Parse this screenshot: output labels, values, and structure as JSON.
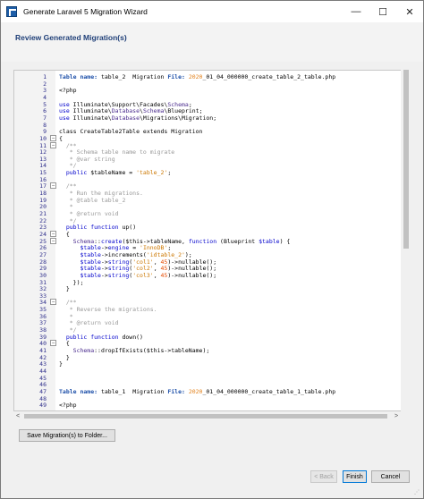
{
  "window": {
    "title": "Generate Laravel 5 Migration Wizard",
    "controls": {
      "minimize": "—",
      "maximize": "☐",
      "close": "✕"
    }
  },
  "header": {
    "title": "Review Generated Migration(s)"
  },
  "editor": {
    "lines": [
      {
        "n": "1",
        "segments": [
          [
            "hdr",
            "Table name: "
          ],
          [
            "cls",
            "table_2  Migration "
          ],
          [
            "hdr",
            "File: "
          ],
          [
            "date",
            "2020"
          ],
          [
            "cls",
            "_01_04_000000_create_table_2_table.php"
          ]
        ]
      },
      {
        "n": "2",
        "segments": []
      },
      {
        "n": "3",
        "segments": [
          [
            "cls",
            "<?php"
          ]
        ]
      },
      {
        "n": "4",
        "segments": []
      },
      {
        "n": "5",
        "segments": [
          [
            "kw",
            "use "
          ],
          [
            "cls",
            "Illuminate\\Support\\Facades\\"
          ],
          [
            "nsb",
            "Schema"
          ],
          [
            "cls",
            ";"
          ]
        ]
      },
      {
        "n": "6",
        "segments": [
          [
            "kw",
            "use "
          ],
          [
            "cls",
            "Illuminate\\"
          ],
          [
            "nsb",
            "Database"
          ],
          [
            "cls",
            "\\"
          ],
          [
            "nsb",
            "Schema"
          ],
          [
            "cls",
            "\\Blueprint;"
          ]
        ]
      },
      {
        "n": "7",
        "segments": [
          [
            "kw",
            "use "
          ],
          [
            "cls",
            "Illuminate\\"
          ],
          [
            "nsb",
            "Database"
          ],
          [
            "cls",
            "\\Migrations\\Migration;"
          ]
        ]
      },
      {
        "n": "8",
        "segments": []
      },
      {
        "n": "9",
        "segments": [
          [
            "cls",
            "class CreateTable2Table extends Migration"
          ]
        ]
      },
      {
        "n": "10",
        "segments": [
          [
            "cls",
            "{"
          ]
        ],
        "fold": true
      },
      {
        "n": "11",
        "segments": [
          [
            "cm",
            "  /**"
          ]
        ],
        "fold": true
      },
      {
        "n": "12",
        "segments": [
          [
            "cm",
            "   * Schema table name to migrate"
          ]
        ]
      },
      {
        "n": "13",
        "segments": [
          [
            "cm",
            "   * @var string"
          ]
        ]
      },
      {
        "n": "14",
        "segments": [
          [
            "cm",
            "   */"
          ]
        ]
      },
      {
        "n": "15",
        "segments": [
          [
            "kw",
            "  public "
          ],
          [
            "cls",
            "$tableName = "
          ],
          [
            "str",
            "'table_2'"
          ],
          [
            "cls",
            ";"
          ]
        ]
      },
      {
        "n": "16",
        "segments": []
      },
      {
        "n": "17",
        "segments": [
          [
            "cm",
            "  /**"
          ]
        ],
        "fold": true
      },
      {
        "n": "18",
        "segments": [
          [
            "cm",
            "   * Run the migrations."
          ]
        ]
      },
      {
        "n": "19",
        "segments": [
          [
            "cm",
            "   * @table table_2"
          ]
        ]
      },
      {
        "n": "20",
        "segments": [
          [
            "cm",
            "   *"
          ]
        ]
      },
      {
        "n": "21",
        "segments": [
          [
            "cm",
            "   * @return void"
          ]
        ]
      },
      {
        "n": "22",
        "segments": [
          [
            "cm",
            "   */"
          ]
        ]
      },
      {
        "n": "23",
        "segments": [
          [
            "kw",
            "  public function "
          ],
          [
            "cls",
            "up()"
          ]
        ]
      },
      {
        "n": "24",
        "segments": [
          [
            "cls",
            "  {"
          ]
        ],
        "fold": true
      },
      {
        "n": "25",
        "segments": [
          [
            "nsb",
            "    Schema"
          ],
          [
            "cls",
            "::"
          ],
          [
            "kw",
            "create"
          ],
          [
            "cls",
            "($this->tableName, "
          ],
          [
            "kw",
            "function "
          ],
          [
            "cls",
            "(Blueprint "
          ],
          [
            "kw",
            "$table"
          ],
          [
            "cls",
            ") {"
          ]
        ],
        "fold": true
      },
      {
        "n": "26",
        "segments": [
          [
            "kw",
            "      $table"
          ],
          [
            "cls",
            "->"
          ],
          [
            "kw",
            "engine "
          ],
          [
            "cls",
            "= "
          ],
          [
            "str",
            "'InnoDB'"
          ],
          [
            "cls",
            ";"
          ]
        ]
      },
      {
        "n": "27",
        "segments": [
          [
            "kw",
            "      $table"
          ],
          [
            "cls",
            "->increments("
          ],
          [
            "str",
            "'idtable_2'"
          ],
          [
            "cls",
            ");"
          ]
        ]
      },
      {
        "n": "28",
        "segments": [
          [
            "kw",
            "      $table"
          ],
          [
            "cls",
            "->"
          ],
          [
            "kw",
            "string"
          ],
          [
            "cls",
            "("
          ],
          [
            "str",
            "'col1'"
          ],
          [
            "cls",
            ", "
          ],
          [
            "num",
            "45"
          ],
          [
            "cls",
            ")->nullable();"
          ]
        ]
      },
      {
        "n": "29",
        "segments": [
          [
            "kw",
            "      $table"
          ],
          [
            "cls",
            "->"
          ],
          [
            "kw",
            "string"
          ],
          [
            "cls",
            "("
          ],
          [
            "str",
            "'col2'"
          ],
          [
            "cls",
            ", "
          ],
          [
            "num",
            "45"
          ],
          [
            "cls",
            ")->nullable();"
          ]
        ]
      },
      {
        "n": "30",
        "segments": [
          [
            "kw",
            "      $table"
          ],
          [
            "cls",
            "->"
          ],
          [
            "kw",
            "string"
          ],
          [
            "cls",
            "("
          ],
          [
            "str",
            "'col3'"
          ],
          [
            "cls",
            ", "
          ],
          [
            "num",
            "45"
          ],
          [
            "cls",
            ")->nullable();"
          ]
        ]
      },
      {
        "n": "31",
        "segments": [
          [
            "cls",
            "    });"
          ]
        ]
      },
      {
        "n": "32",
        "segments": [
          [
            "cls",
            "  }"
          ]
        ]
      },
      {
        "n": "33",
        "segments": []
      },
      {
        "n": "34",
        "segments": [
          [
            "cm",
            "  /**"
          ]
        ],
        "fold": true
      },
      {
        "n": "35",
        "segments": [
          [
            "cm",
            "   * Reverse the migrations."
          ]
        ]
      },
      {
        "n": "36",
        "segments": [
          [
            "cm",
            "   *"
          ]
        ]
      },
      {
        "n": "37",
        "segments": [
          [
            "cm",
            "   * @return void"
          ]
        ]
      },
      {
        "n": "38",
        "segments": [
          [
            "cm",
            "   */"
          ]
        ]
      },
      {
        "n": "39",
        "segments": [
          [
            "kw",
            "  public function "
          ],
          [
            "cls",
            "down()"
          ]
        ]
      },
      {
        "n": "40",
        "segments": [
          [
            "cls",
            "  {"
          ]
        ],
        "fold": true
      },
      {
        "n": "41",
        "segments": [
          [
            "nsb",
            "    Schema"
          ],
          [
            "cls",
            "::dropIfExists($this->tableName);"
          ]
        ]
      },
      {
        "n": "42",
        "segments": [
          [
            "cls",
            "  }"
          ]
        ]
      },
      {
        "n": "43",
        "segments": [
          [
            "cls",
            "}"
          ]
        ]
      },
      {
        "n": "44",
        "segments": []
      },
      {
        "n": "45",
        "segments": []
      },
      {
        "n": "46",
        "segments": []
      },
      {
        "n": "47",
        "segments": [
          [
            "hdr",
            "Table name: "
          ],
          [
            "cls",
            "table_1  Migration "
          ],
          [
            "hdr",
            "File: "
          ],
          [
            "date",
            "2020"
          ],
          [
            "cls",
            "_01_04_000000_create_table_1_table.php"
          ]
        ]
      },
      {
        "n": "48",
        "segments": []
      },
      {
        "n": "49",
        "segments": [
          [
            "cls",
            "<?php"
          ]
        ]
      }
    ]
  },
  "buttons": {
    "save": "Save Migration(s) to Folder...",
    "back": "< Back",
    "finish": "Finish",
    "cancel": "Cancel"
  },
  "scroll": {
    "left_arrow": "<",
    "right_arrow": ">"
  }
}
